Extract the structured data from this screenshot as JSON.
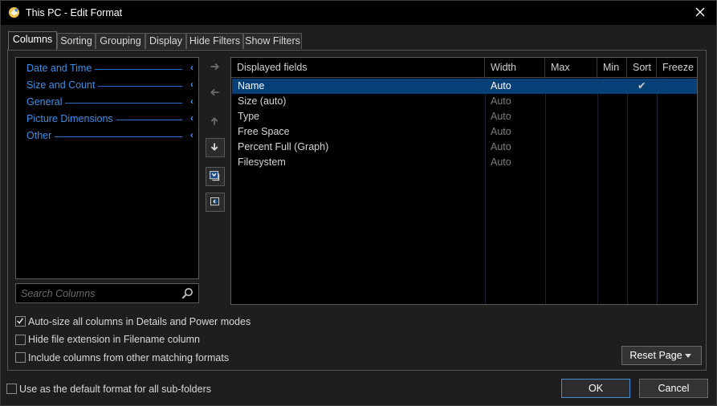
{
  "window": {
    "title": "This PC - Edit Format"
  },
  "tabs": [
    {
      "label": "Columns",
      "active": true
    },
    {
      "label": "Sorting"
    },
    {
      "label": "Grouping"
    },
    {
      "label": "Display"
    },
    {
      "label": "Hide Filters"
    },
    {
      "label": "Show Filters"
    }
  ],
  "categories": [
    {
      "label": "Date and Time"
    },
    {
      "label": "Size and Count"
    },
    {
      "label": "General"
    },
    {
      "label": "Picture Dimensions"
    },
    {
      "label": "Other"
    }
  ],
  "search": {
    "placeholder": "Search Columns"
  },
  "side_buttons": [
    "arrow-right-icon",
    "arrow-left-icon",
    "arrow-up-icon",
    "arrow-down-icon",
    "collapse-icon",
    "expand-icon"
  ],
  "table": {
    "headers": [
      "Displayed fields",
      "Width",
      "Max",
      "Min",
      "Sort",
      "Freeze"
    ],
    "rows": [
      {
        "field": "Name",
        "width": "Auto",
        "sort": "✔",
        "selected": true
      },
      {
        "field": "Size (auto)",
        "width": "Auto"
      },
      {
        "field": "Type",
        "width": "Auto"
      },
      {
        "field": "Free Space",
        "width": "Auto"
      },
      {
        "field": "Percent Full (Graph)",
        "width": "Auto"
      },
      {
        "field": "Filesystem",
        "width": "Auto"
      }
    ]
  },
  "options": {
    "autosize": {
      "label": "Auto-size all columns in Details and Power modes",
      "checked": true
    },
    "hide_ext": {
      "label": "Hide file extension in Filename column",
      "checked": false
    },
    "include_other": {
      "label": "Include columns from other matching formats",
      "checked": false
    },
    "default_subfolders": {
      "label": "Use as the default format for all sub-folders",
      "checked": false
    }
  },
  "buttons": {
    "reset": "Reset Page",
    "ok": "OK",
    "cancel": "Cancel"
  },
  "colors": {
    "accent": "#3d8fe8",
    "selection": "#073f77",
    "background": "#1e1e1e"
  }
}
